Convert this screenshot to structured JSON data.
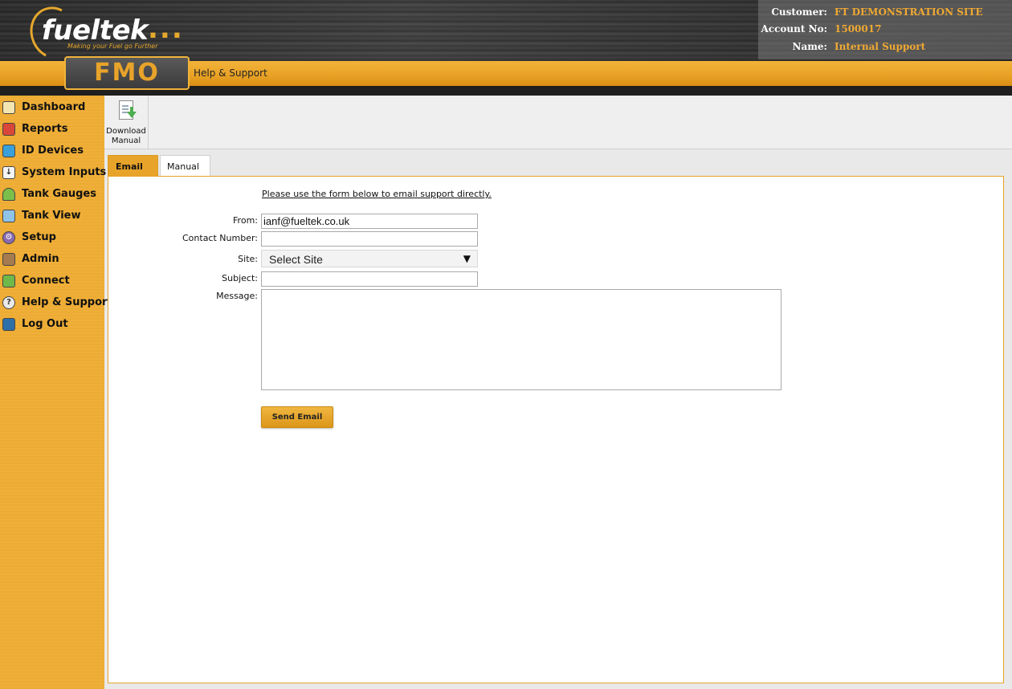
{
  "brand": {
    "logo_word": "fueltek",
    "logo_dots": "...",
    "tagline": "Making your Fuel go Further",
    "product": "FMO",
    "accent_color": "#e8a32a",
    "text_accent_color": "#f0a933"
  },
  "account": {
    "customer_label": "Customer:",
    "customer_value": "FT DEMONSTRATION SITE",
    "account_label": "Account No:",
    "account_value": "1500017",
    "name_label": "Name:",
    "name_value": "Internal Support"
  },
  "header": {
    "page_title": "Help & Support"
  },
  "sidebar": {
    "items": [
      {
        "label": "Dashboard",
        "icon": "dashboard-icon"
      },
      {
        "label": "Reports",
        "icon": "reports-icon"
      },
      {
        "label": "ID Devices",
        "icon": "id-devices-icon"
      },
      {
        "label": "System Inputs",
        "icon": "system-inputs-icon"
      },
      {
        "label": "Tank Gauges",
        "icon": "tank-gauges-icon"
      },
      {
        "label": "Tank View",
        "icon": "tank-view-icon"
      },
      {
        "label": "Setup",
        "icon": "setup-gear-icon"
      },
      {
        "label": "Admin",
        "icon": "admin-icon"
      },
      {
        "label": "Connect",
        "icon": "connect-icon"
      },
      {
        "label": "Help & Support",
        "icon": "help-icon"
      },
      {
        "label": "Log Out",
        "icon": "logout-icon"
      }
    ]
  },
  "toolbar": {
    "download_line1": "Download",
    "download_line2": "Manual"
  },
  "tabs": {
    "email": "Email",
    "manual": "Manual"
  },
  "form": {
    "intro": "Please use the form below to email support directly.",
    "from_label": "From:",
    "from_value": "ianf@fueltek.co.uk",
    "contact_label": "Contact Number:",
    "contact_value": "",
    "site_label": "Site:",
    "site_value": "Select Site",
    "subject_label": "Subject:",
    "subject_value": "",
    "message_label": "Message:",
    "message_value": "",
    "send_label": "Send Email"
  }
}
